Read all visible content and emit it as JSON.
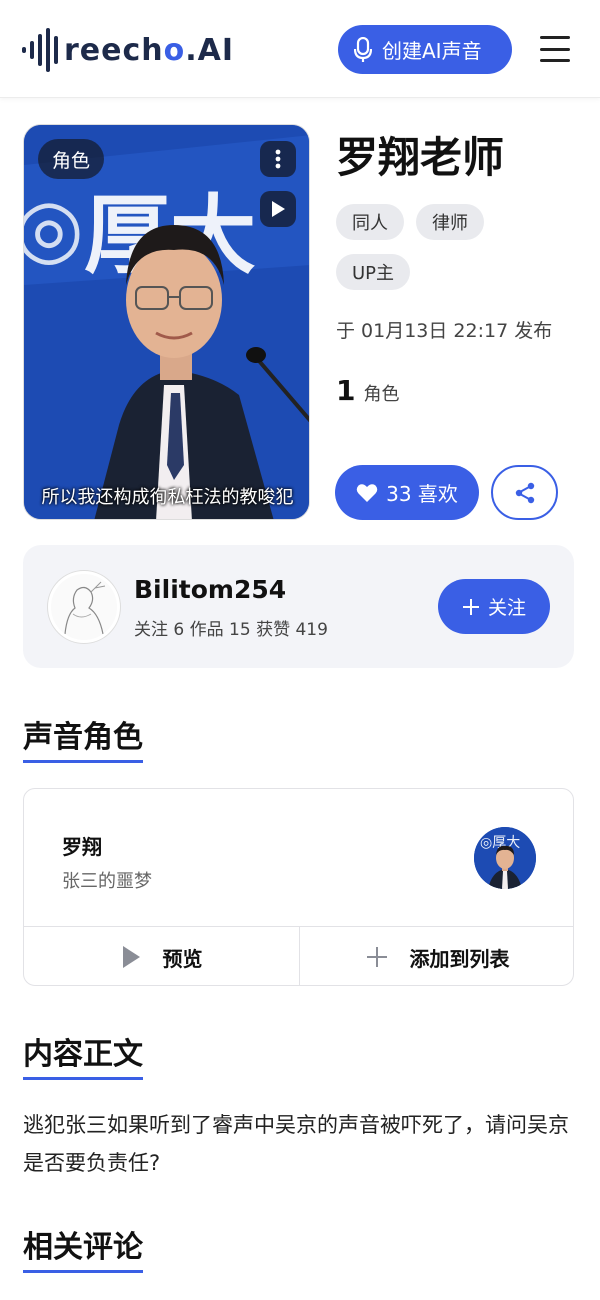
{
  "header": {
    "logo_text_before": "reech",
    "logo_o": "o",
    "logo_text_after": ".AI",
    "create_button": "创建AI声音"
  },
  "cover": {
    "badge": "角色",
    "subtitle": "所以我还构成徇私枉法的教唆犯"
  },
  "info": {
    "title": "罗翔老师",
    "tags": [
      "同人",
      "律师",
      "UP主"
    ],
    "published": "于 01月13日 22:17 发布",
    "role_count": "1",
    "role_label": "角色",
    "like_label": "33 喜欢"
  },
  "author": {
    "name": "Bilitom254",
    "stats": "关注 6 作品 15 获赞 419",
    "follow_label": "关注"
  },
  "sections": {
    "voice_roles": "声音角色",
    "content": "内容正文",
    "comments": "相关评论"
  },
  "voice_role": {
    "name": "罗翔",
    "subtitle": "张三的噩梦",
    "preview_label": "预览",
    "add_label": "添加到列表"
  },
  "content_text": "逃犯张三如果听到了睿声中吴京的声音被吓死了，请问吴京是否要负责任?",
  "colors": {
    "accent": "#3a5fe5",
    "tag_bg": "#e9eaee",
    "card_bg": "#f3f4f8"
  }
}
